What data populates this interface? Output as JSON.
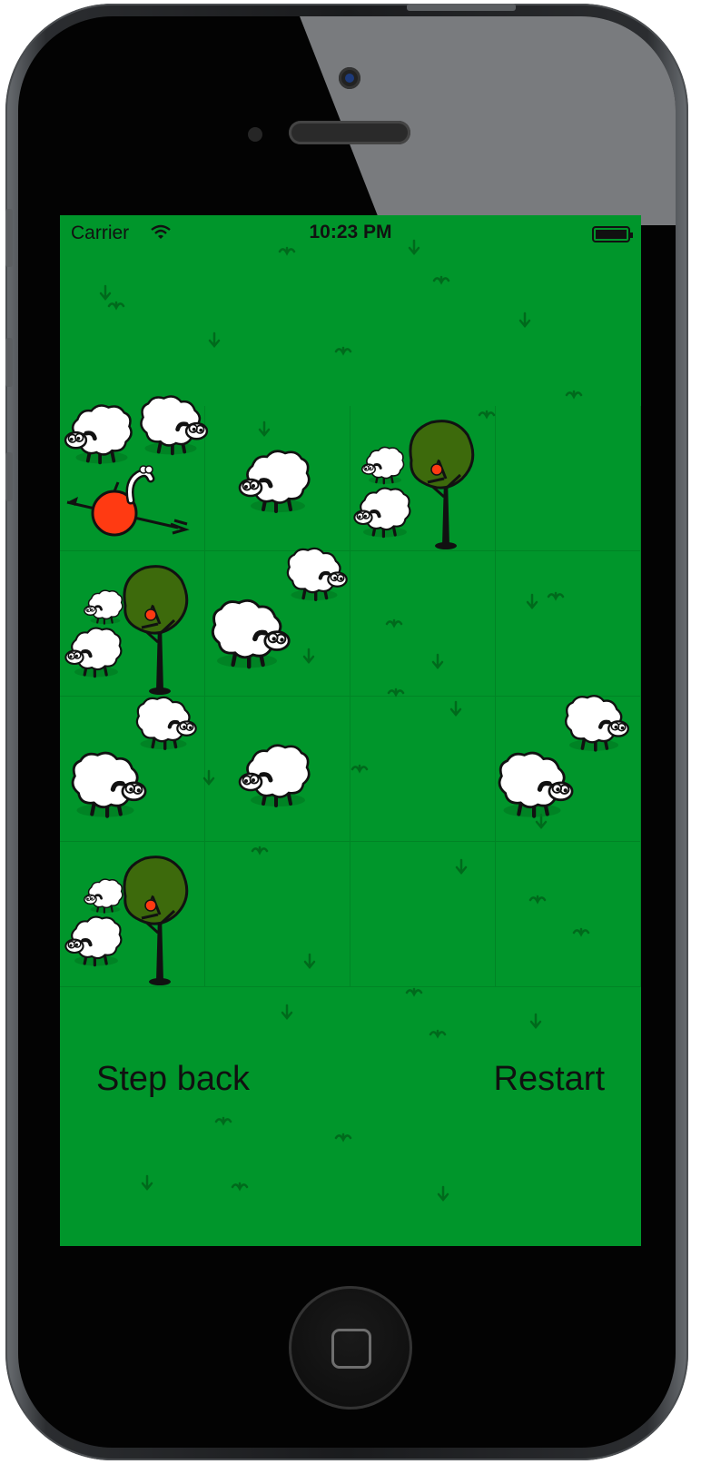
{
  "status_bar": {
    "carrier": "Carrier",
    "time": "10:23 PM",
    "wifi_icon": "wifi-icon",
    "battery_icon": "battery-icon"
  },
  "board": {
    "rows": 4,
    "cols": 4,
    "colors": {
      "grass": "#00962b",
      "apple": "#ff3a12",
      "tree_crown": "#3c6b0a",
      "sheep": "#ffffff"
    }
  },
  "controls": {
    "step_back": "Step back",
    "restart": "Restart"
  }
}
